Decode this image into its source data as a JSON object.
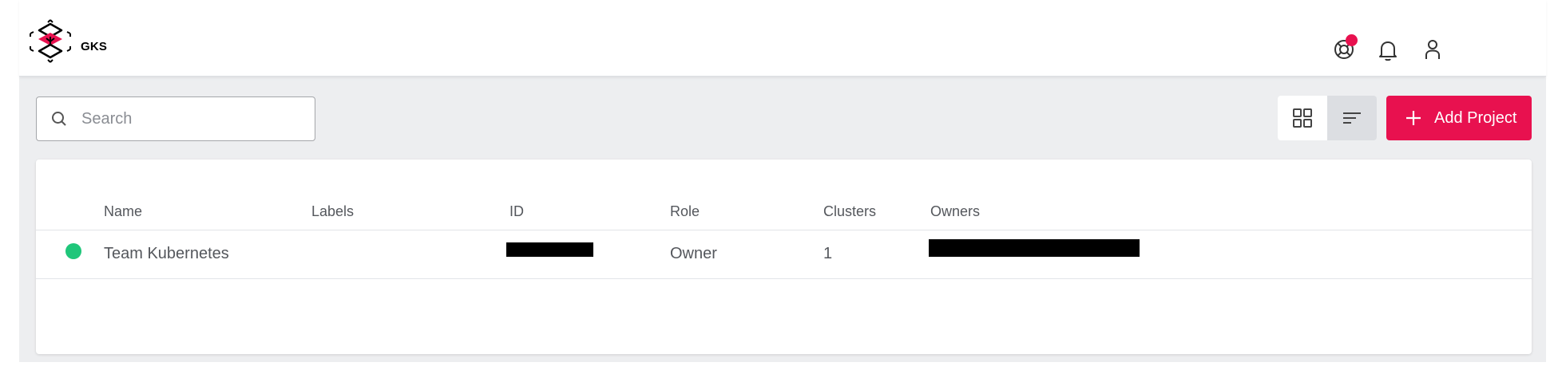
{
  "app": {
    "brand": "GKS"
  },
  "colors": {
    "accent": "#e8114f",
    "status_ok": "#1fc67a",
    "redacted": "#000000"
  },
  "header": {
    "icons": [
      {
        "name": "support-icon",
        "has_badge": true
      },
      {
        "name": "bell-icon",
        "has_badge": false
      },
      {
        "name": "user-icon",
        "has_badge": false
      }
    ]
  },
  "toolbar": {
    "search_placeholder": "Search",
    "search_value": "",
    "view_modes": [
      "grid",
      "list"
    ],
    "active_view": "list",
    "add_label": "Add Project"
  },
  "table": {
    "columns": [
      "",
      "Name",
      "Labels",
      "ID",
      "Role",
      "Clusters",
      "Owners"
    ],
    "rows": [
      {
        "status": "active",
        "name": "Team Kubernetes",
        "labels": "",
        "id": "[redacted]",
        "role": "Owner",
        "clusters": "1",
        "owners": "[redacted]"
      }
    ]
  }
}
